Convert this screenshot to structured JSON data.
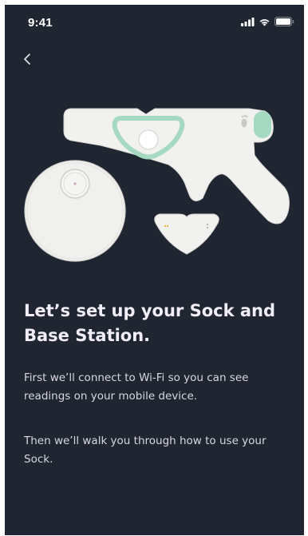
{
  "status_bar": {
    "time": "9:41",
    "signal_icon": "cellular-signal-icon",
    "wifi_icon": "wifi-icon",
    "battery_icon": "battery-icon"
  },
  "navigation": {
    "back_icon": "chevron-left-icon"
  },
  "illustration": {
    "description_icon": "sock-and-base-station-illustration",
    "accent_color": "#a6d9c2"
  },
  "content": {
    "headline": "Let’s set up your Sock and Base Station.",
    "paragraph_1": "First we’ll connect to Wi-Fi so you can see readings on your mobile device.",
    "paragraph_2": "Then we’ll walk you through how to use your Sock."
  },
  "colors": {
    "background": "#1f2631",
    "headline": "#f1eef7",
    "body_text": "#d9d6e0",
    "device_white": "#f1f1ef",
    "accent_green": "#a6d9c2"
  }
}
